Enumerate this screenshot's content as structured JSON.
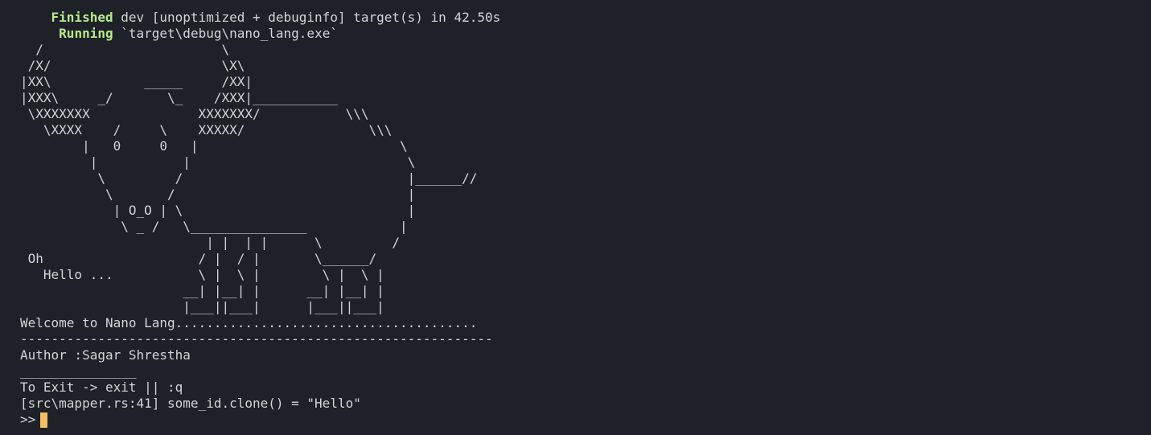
{
  "build": {
    "finished_keyword": "Finished",
    "finished_text": " dev [unoptimized + debuginfo] target(s) in 42.50s",
    "running_keyword": "Running",
    "running_text": " `target\\debug\\nano_lang.exe`"
  },
  "art_lines": [
    "  /                       \\",
    " /X/                      \\X\\",
    "|XX\\            _____     /XX|",
    "|XXX\\     _/       \\_    /XXX|___________",
    " \\XXXXXXX              XXXXXXX/           \\\\\\",
    "   \\XXXX    /     \\    XXXXX/                \\\\\\",
    "        |   0     0   |                          \\",
    "         |           |                            \\",
    "          \\         /                             |______//",
    "           \\       /                              |",
    "            | O_O | \\                             |",
    "             \\ _ /   \\_______________            |",
    "                        | |  | |      \\         /",
    " Oh                    / |  / |       \\______/",
    "   Hello ...           \\ |  \\ |        \\ |  \\ |",
    "                     __| |__| |      __| |__| |",
    "                     |___||___|      |___||___|"
  ],
  "welcome": "Welcome to Nano Lang.......................................",
  "separator": "-------------------------------------------------------------",
  "author": "Author :Sagar Shrestha",
  "underline": "_______________",
  "exit_hint": "To Exit -> exit || :q",
  "debug_output": "[src\\mapper.rs:41] some_id.clone() = \"Hello\"",
  "prompt": ">>",
  "colors": {
    "background": "#1e2127",
    "foreground": "#d4d4d4",
    "keyword": "#b9e98c",
    "cursor": "#f1c060"
  }
}
